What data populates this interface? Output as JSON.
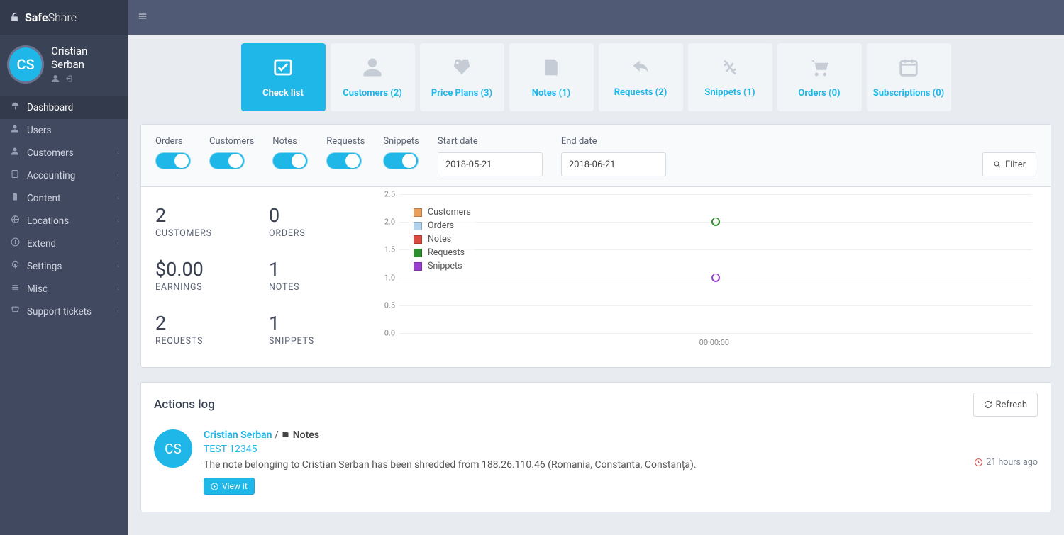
{
  "brand": {
    "bold": "Safe",
    "light": "Share"
  },
  "user": {
    "name": "Cristian Serban",
    "initials": "CS"
  },
  "sidebar": {
    "items": [
      {
        "label": "Dashboard",
        "icon": "dashboard",
        "active": true,
        "sub": false
      },
      {
        "label": "Users",
        "icon": "user",
        "sub": false
      },
      {
        "label": "Customers",
        "icon": "user",
        "sub": true
      },
      {
        "label": "Accounting",
        "icon": "calc",
        "sub": true
      },
      {
        "label": "Content",
        "icon": "doc",
        "sub": true
      },
      {
        "label": "Locations",
        "icon": "globe",
        "sub": true
      },
      {
        "label": "Extend",
        "icon": "plus",
        "sub": true
      },
      {
        "label": "Settings",
        "icon": "cog",
        "sub": true
      },
      {
        "label": "Misc",
        "icon": "list",
        "sub": true
      },
      {
        "label": "Support tickets",
        "icon": "ticket",
        "sub": true
      }
    ]
  },
  "tabs": [
    {
      "label": "Check list",
      "active": true
    },
    {
      "label": "Customers (2)"
    },
    {
      "label": "Price Plans (3)"
    },
    {
      "label": "Notes (1)"
    },
    {
      "label": "Requests (2)"
    },
    {
      "label": "Snippets (1)"
    },
    {
      "label": "Orders (0)"
    },
    {
      "label": "Subscriptions (0)"
    }
  ],
  "filters": {
    "toggles": [
      "Orders",
      "Customers",
      "Notes",
      "Requests",
      "Snippets"
    ],
    "start_label": "Start date",
    "start_value": "2018-05-21",
    "end_label": "End date",
    "end_value": "2018-06-21",
    "button": "Filter"
  },
  "stats": [
    {
      "num": "2",
      "lbl": "CUSTOMERS"
    },
    {
      "num": "0",
      "lbl": "ORDERS"
    },
    {
      "num": "$0.00",
      "lbl": "EARNINGS"
    },
    {
      "num": "1",
      "lbl": "NOTES"
    },
    {
      "num": "2",
      "lbl": "REQUESTS"
    },
    {
      "num": "1",
      "lbl": "SNIPPETS"
    }
  ],
  "chart_data": {
    "type": "scatter",
    "ylim": [
      0,
      2.5
    ],
    "y_ticks": [
      0.0,
      0.5,
      1.0,
      1.5,
      2.0,
      2.5
    ],
    "x_tick": "00:00:00",
    "series": [
      {
        "name": "Customers",
        "color": "#e8a05c"
      },
      {
        "name": "Orders",
        "color": "#b3d2ec"
      },
      {
        "name": "Notes",
        "color": "#d94a3f"
      },
      {
        "name": "Requests",
        "color": "#2f8f2f",
        "points": [
          {
            "x": 0.5,
            "y": 2
          }
        ]
      },
      {
        "name": "Snippets",
        "color": "#9b3fcf",
        "points": [
          {
            "x": 0.5,
            "y": 1
          }
        ]
      }
    ]
  },
  "log": {
    "title": "Actions log",
    "refresh": "Refresh",
    "item": {
      "user": "Cristian Serban",
      "sep": " / ",
      "cat": "Notes",
      "title": "TEST 12345",
      "desc": "The note belonging to Cristian Serban has been shredded from 188.26.110.46 (Romania, Constanta, Constanța).",
      "view": "View it",
      "time": "21 hours ago",
      "initials": "CS"
    }
  }
}
